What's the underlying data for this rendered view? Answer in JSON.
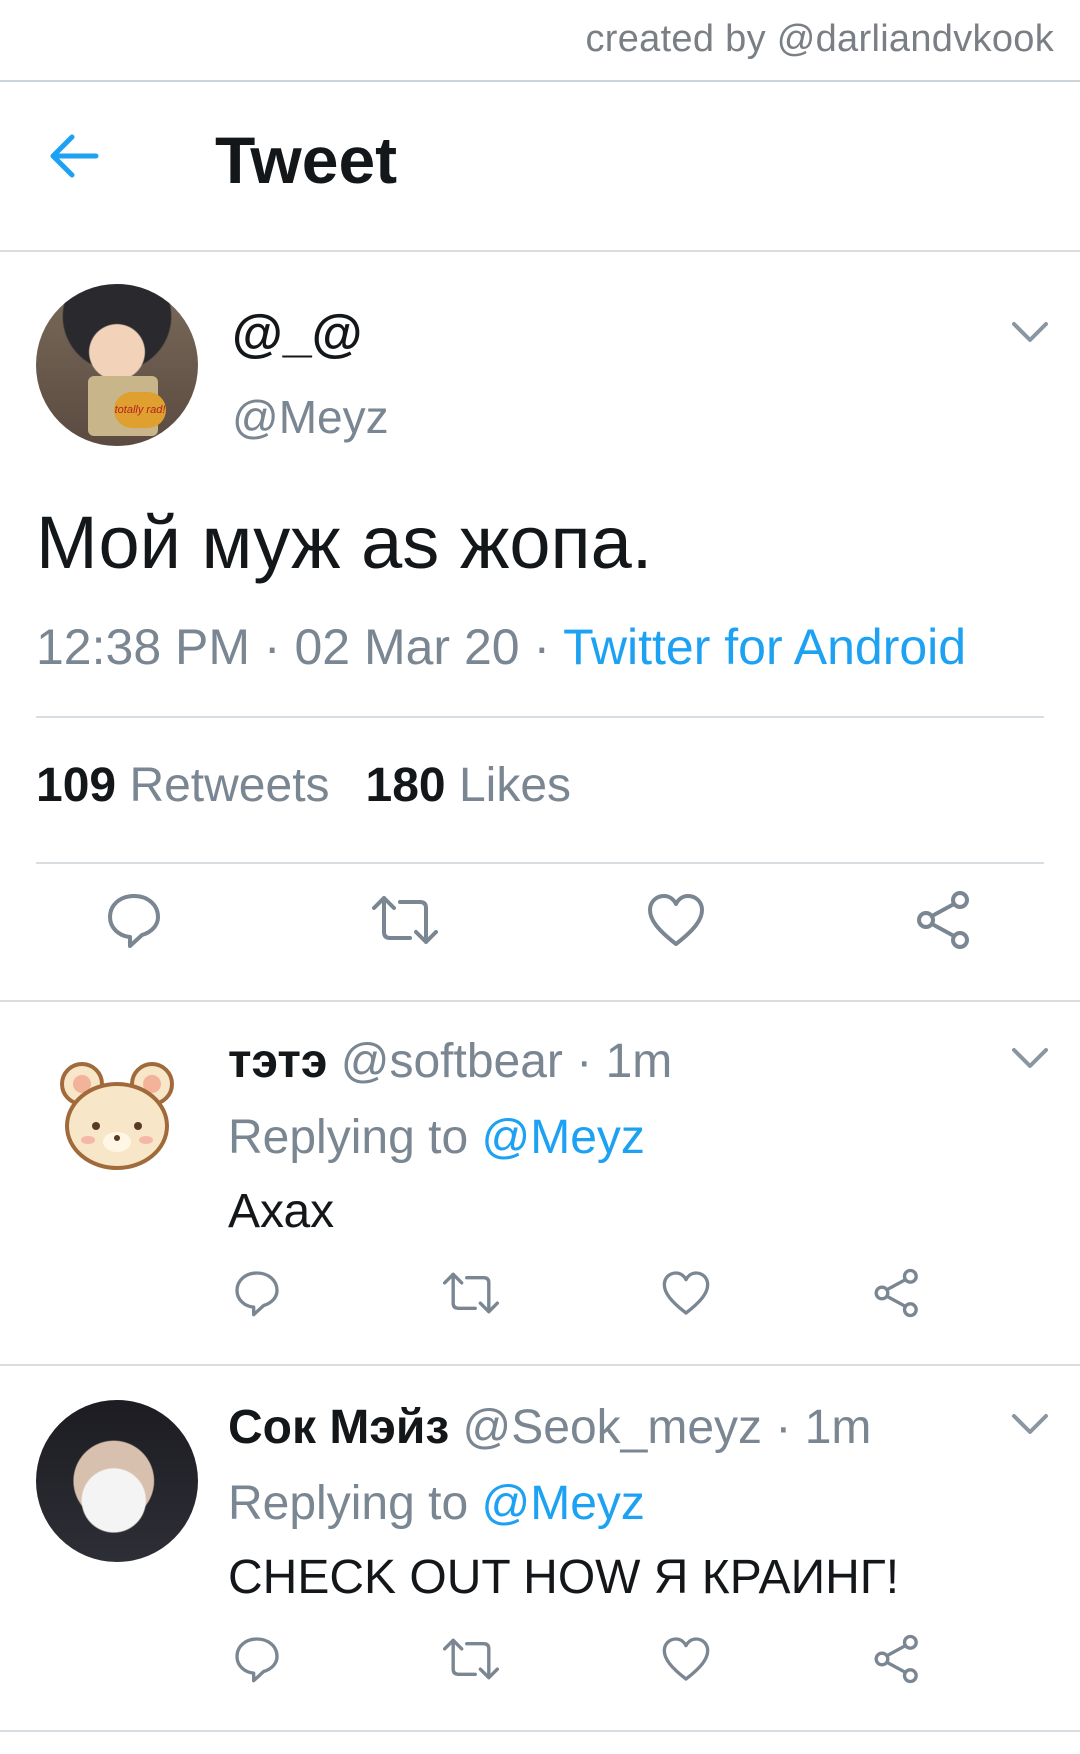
{
  "credit": "created by @darliandvkook",
  "header": {
    "title": "Tweet",
    "back_icon": "arrow-left-icon"
  },
  "colors": {
    "accent": "#1da1f2",
    "muted": "#7a8692",
    "text": "#14171a",
    "divider": "#d8dde2"
  },
  "tweet": {
    "display_name": "@_@",
    "handle": "@Meyz",
    "text": "Мой муж as жопа.",
    "time": "12:38 PM",
    "date": "02 Mar 20",
    "source": "Twitter for Android",
    "sep": " · ",
    "retweets_count": "109",
    "retweets_label": "Retweets",
    "likes_count": "180",
    "likes_label": "Likes",
    "avatar_sticker": "totally rad!"
  },
  "replies": [
    {
      "display_name": "тэтэ",
      "handle": "@softbear",
      "time": "1m",
      "replying_label": "Replying to",
      "replying_to": "@Meyz",
      "text": "Ахах"
    },
    {
      "display_name": "Сок Мэйз",
      "handle": "@Seok_meyz",
      "time": "1m",
      "replying_label": "Replying to",
      "replying_to": "@Meyz",
      "text": "CHECK OUT HOW Я КРАИНГ!"
    }
  ]
}
